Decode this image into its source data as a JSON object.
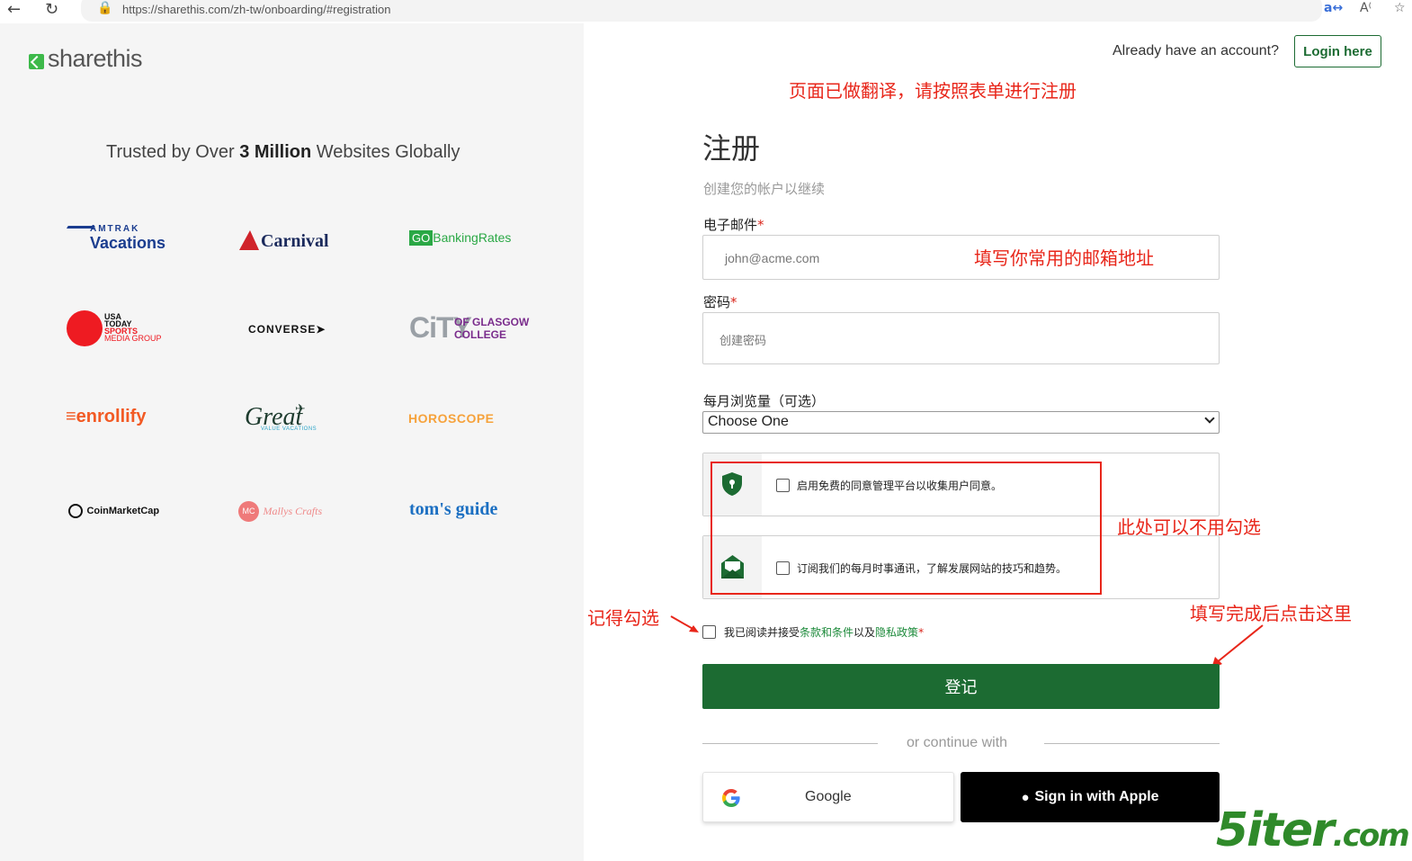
{
  "browser": {
    "url": "https://sharethis.com/zh-tw/onboarding/#registration"
  },
  "left": {
    "logo_text": "sharethis",
    "trusted_pre": "Trusted by Over ",
    "trusted_bold": "3 Million",
    "trusted_post": " Websites Globally",
    "brands": {
      "amtrak_top": "AMTRAK",
      "amtrak_bottom": "Vacations",
      "carnival": "Carnival",
      "gobanking_go": "GO",
      "gobanking_rest": "BankingRates",
      "usatoday": [
        "USA",
        "TODAY",
        "SPORTS",
        "MEDIA GROUP"
      ],
      "converse": "CONVERSE",
      "city_big": "CiTY",
      "city_small1": "OF GLASGOW",
      "city_small2": "COLLEGE",
      "enrollify": "enrollify",
      "great": "Great",
      "great_sub": "VALUE VACATIONS",
      "horoscope": "HOROSCOPE",
      "coinmarketcap": "CoinMarketCap",
      "mallys": "Mallys Crafts",
      "mallys_badge": "MC",
      "toms": "tom's guide"
    }
  },
  "header": {
    "already": "Already have an account?",
    "login_label": "Login here"
  },
  "notes": {
    "top": "页面已做翻译，请按照表单进行注册",
    "email": "填写你常用的邮箱地址",
    "optional": "此处可以不用勾选",
    "remember": "记得勾选",
    "submit": "填写完成后点击这里"
  },
  "form": {
    "title": "注册",
    "subtitle": "创建您的帐户以继续",
    "email_label": "电子邮件",
    "email_placeholder": "john@acme.com",
    "password_label": "密码",
    "password_placeholder": "创建密码",
    "traffic_label": "每月浏览量（可选）",
    "traffic_selected": "Choose One",
    "consent_text": "启用免费的同意管理平台以收集用户同意。",
    "newsletter_text": "订阅我们的每月时事通讯，了解发展网站的技巧和趋势。",
    "terms_pre": "我已阅读并接受",
    "terms_link": "条款和条件",
    "terms_mid": "以及",
    "privacy_link": "隐私政策",
    "required_mark": "*",
    "submit_label": "登记",
    "or_continue": "or continue with",
    "google_label": "Google",
    "apple_label": "Sign in with Apple"
  },
  "watermark": {
    "main": "5iter",
    "suffix": ".com"
  },
  "colors": {
    "brand_green": "#1c6b32",
    "annotation_red": "#e8261a"
  }
}
